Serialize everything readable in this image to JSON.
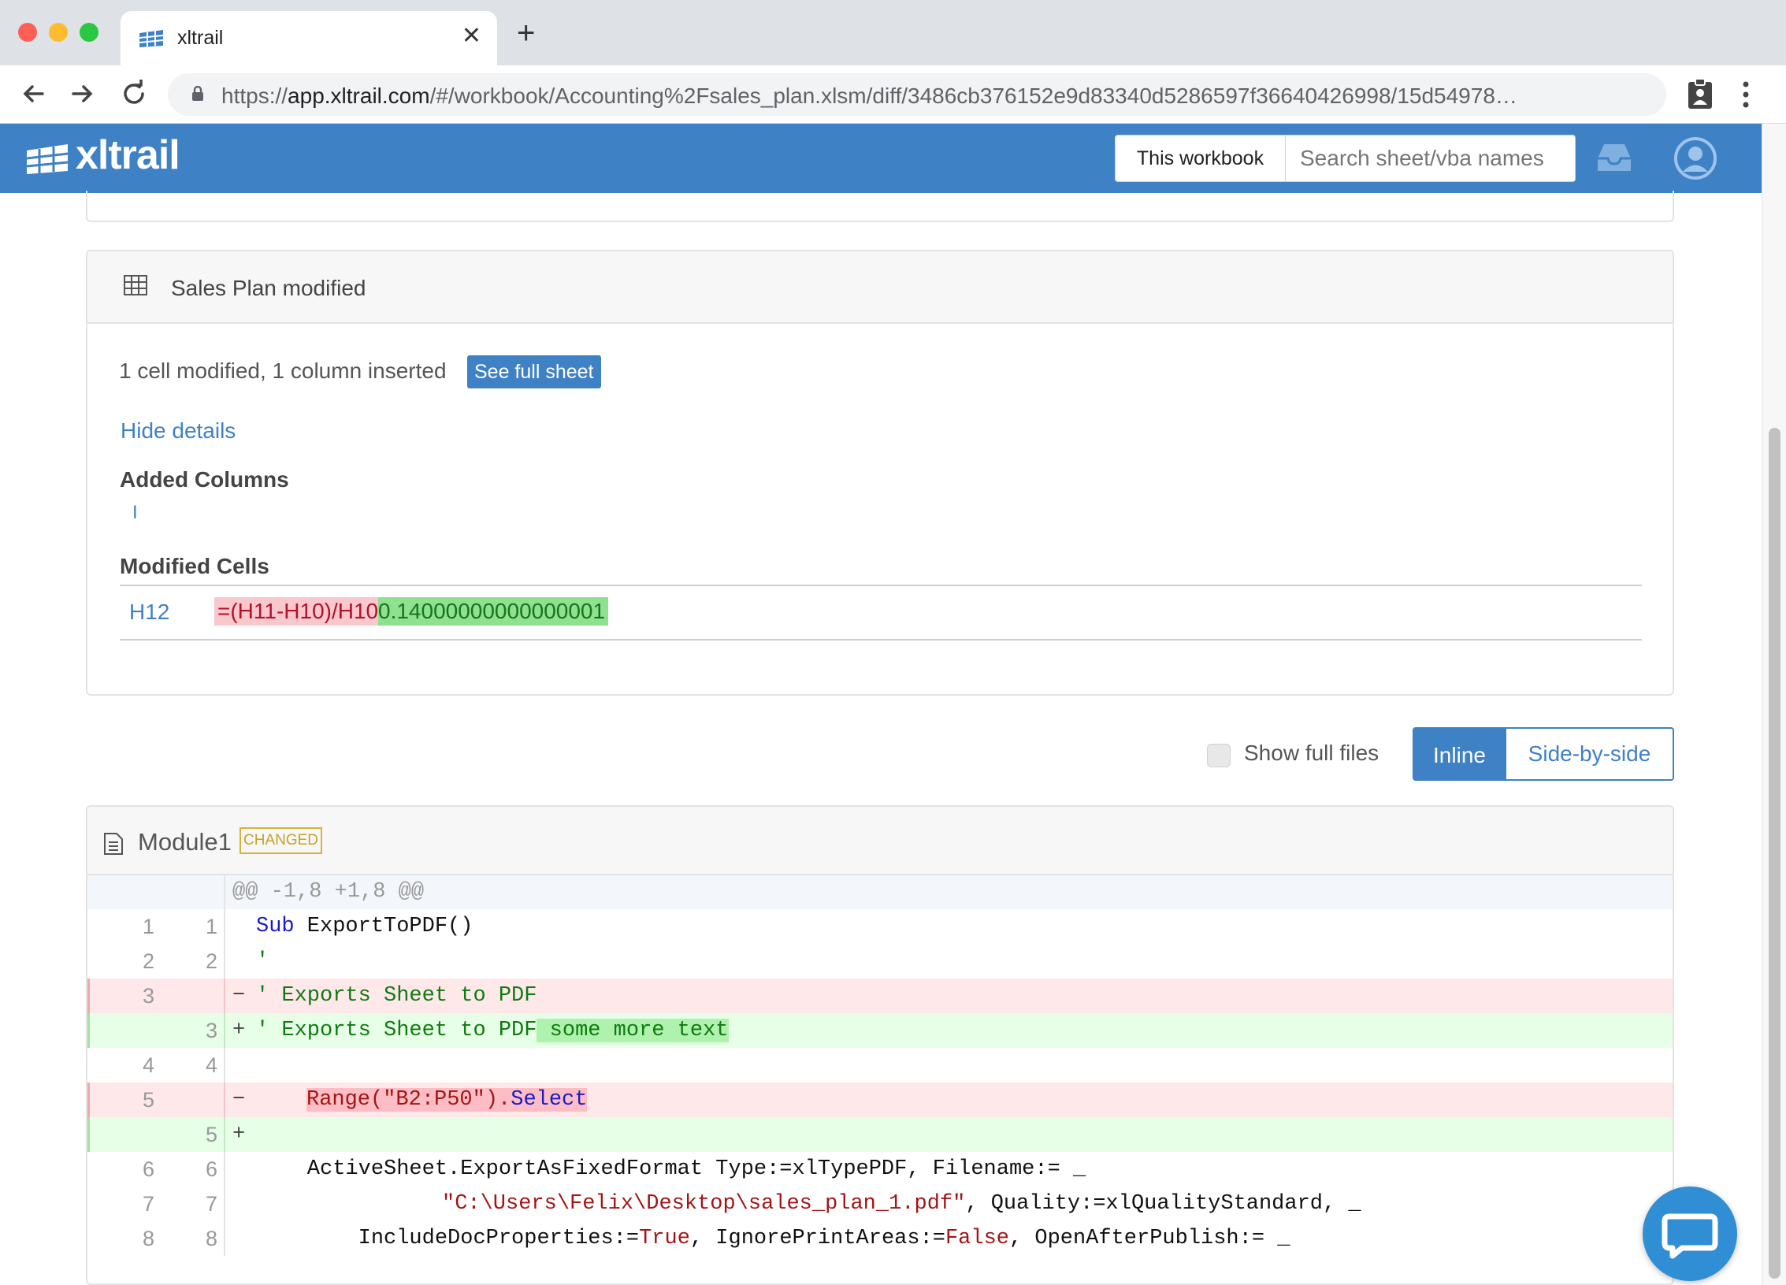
{
  "browser": {
    "tab_title": "xltrail",
    "tab_close": "✕",
    "new_tab": "+",
    "url_prefix": "https://",
    "url_host": "app.xltrail.com",
    "url_path": "/#/workbook/Accounting%2Fsales_plan.xlsm/diff/3486cb376152e9d83340d5286597f36640426998/15d54978…"
  },
  "header": {
    "logo_text": "xltrail",
    "scope_button": "This workbook",
    "search_placeholder": "Search sheet/vba names"
  },
  "sheet_card": {
    "title": "Sales Plan modified",
    "summary": "1 cell modified, 1 column inserted",
    "see_full_sheet": "See full sheet",
    "hide_details": "Hide details",
    "added_columns_title": "Added Columns",
    "added_columns": [
      "I"
    ],
    "modified_cells_title": "Modified Cells",
    "modified_cells": [
      {
        "ref": "H12",
        "old": "=(H11-H10)/H10",
        "new": "0.14000000000000001"
      }
    ]
  },
  "view_controls": {
    "show_full_files": "Show full files",
    "inline": "Inline",
    "side_by_side": "Side-by-side"
  },
  "module_card": {
    "name": "Module1",
    "badge": "CHANGED",
    "hunk": "@@ -1,8 +1,8 @@",
    "lines": [
      {
        "old": "1",
        "new": "1",
        "sign": "",
        "type": "ctx"
      },
      {
        "old": "2",
        "new": "2",
        "sign": "",
        "type": "ctx"
      },
      {
        "old": "3",
        "new": "",
        "sign": "−",
        "type": "del"
      },
      {
        "old": "",
        "new": "3",
        "sign": "+",
        "type": "add"
      },
      {
        "old": "4",
        "new": "4",
        "sign": "",
        "type": "ctx"
      },
      {
        "old": "5",
        "new": "",
        "sign": "−",
        "type": "del"
      },
      {
        "old": "",
        "new": "5",
        "sign": "+",
        "type": "add"
      },
      {
        "old": "6",
        "new": "6",
        "sign": "",
        "type": "ctx"
      },
      {
        "old": "7",
        "new": "7",
        "sign": "",
        "type": "ctx"
      },
      {
        "old": "8",
        "new": "8",
        "sign": "",
        "type": "ctx"
      }
    ],
    "code": {
      "l1_kw": "Sub",
      "l1_rest": " ExportToPDF()",
      "l2_comment": "'",
      "l3_comment": "' Exports Sheet to PDF",
      "l3a_comment": "' Exports Sheet to PDF",
      "l3a_added": " some more text",
      "l5_range": "Range(\"B2:P50\").",
      "l5_select": "Select",
      "l6": "    ActiveSheet.ExportAsFixedFormat Type:=xlTypePDF, Filename:= _",
      "l7_str": "\"C:\\Users\\Felix\\Desktop\\sales_plan_1.pdf\"",
      "l7_rest": ", Quality:=xlQualityStandard, _",
      "l8_a": "        IncludeDocProperties:=",
      "l8_true": "True",
      "l8_b": ", IgnorePrintAreas:=",
      "l8_false": "False",
      "l8_c": ", OpenAfterPublish:= _"
    }
  },
  "colors": {
    "brand": "#3f81c5",
    "deleted_bg": "#ffe8ea",
    "added_bg": "#e6ffe6",
    "badge": "#d6b43b"
  }
}
